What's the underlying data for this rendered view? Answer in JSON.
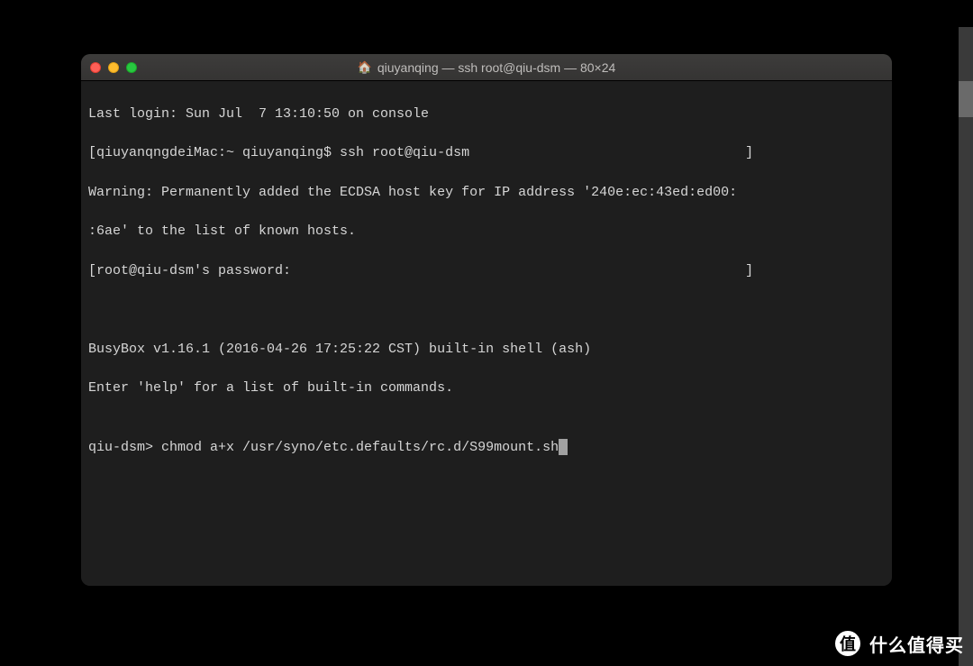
{
  "titlebar": {
    "icon": "home-icon",
    "title": "qiuyanqing — ssh root@qiu-dsm — 80×24"
  },
  "terminal": {
    "lines": [
      "Last login: Sun Jul  7 13:10:50 on console",
      "[qiuyanqngdeiMac:~ qiuyanqing$ ssh root@qiu-dsm                                  ]",
      "Warning: Permanently added the ECDSA host key for IP address '240e:ec:43ed:ed00:",
      ":6ae' to the list of known hosts.",
      "[root@qiu-dsm's password:                                                        ]",
      "",
      "",
      "BusyBox v1.16.1 (2016-04-26 17:25:22 CST) built-in shell (ash)",
      "Enter 'help' for a list of built-in commands.",
      "",
      "qiu-dsm> chmod a+x /usr/syno/etc.defaults/rc.d/S99mount.sh"
    ]
  },
  "watermark": {
    "badge": "值",
    "text": "什么值得买"
  }
}
